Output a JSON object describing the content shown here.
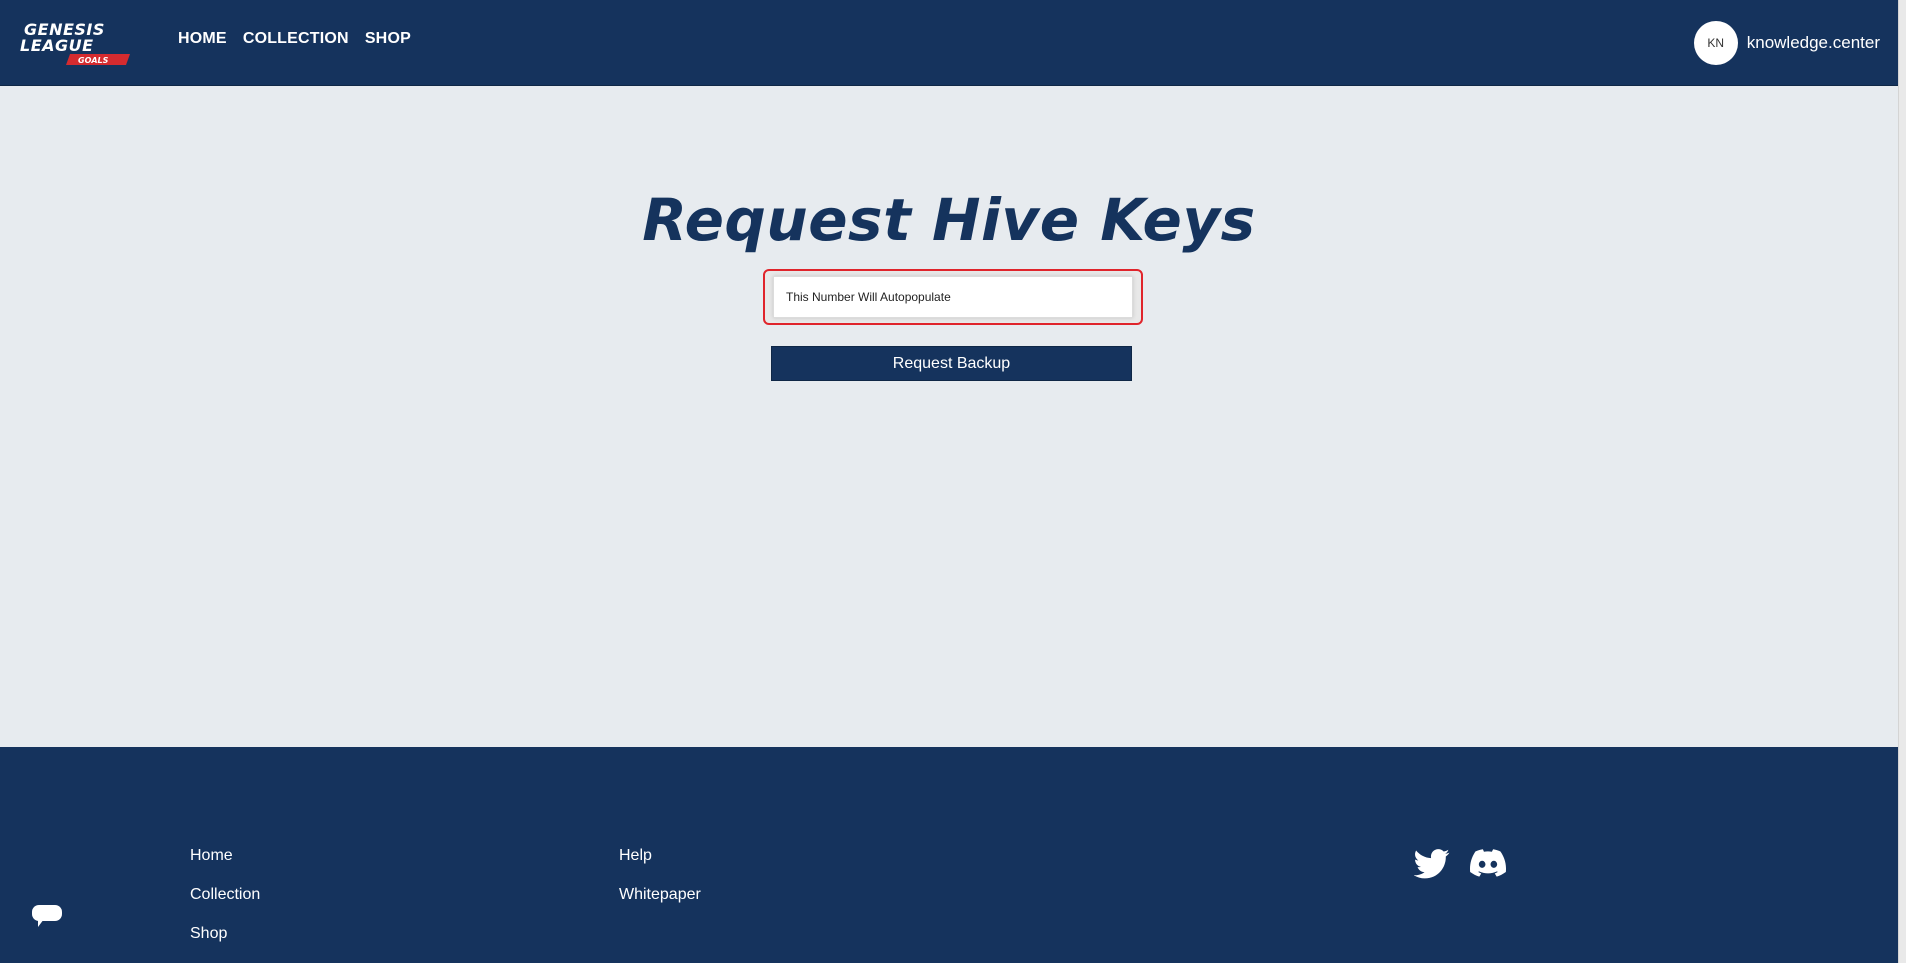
{
  "header": {
    "logo": {
      "line1": "GENESIS",
      "line2": "LEAGUE",
      "line3": "GOALS",
      "accent": "#d52b2f"
    },
    "nav": [
      {
        "label": "HOME"
      },
      {
        "label": "COLLECTION"
      },
      {
        "label": "SHOP"
      }
    ],
    "user": {
      "initials": "KN",
      "name": "knowledge.center"
    }
  },
  "main": {
    "title": "Request Hive Keys",
    "input": {
      "value": "This Number Will Autopopulate",
      "highlight_color": "#e0242b"
    },
    "button_label": "Request Backup"
  },
  "footer": {
    "col1": [
      {
        "label": "Home"
      },
      {
        "label": "Collection"
      },
      {
        "label": "Shop"
      }
    ],
    "col2": [
      {
        "label": "Help"
      },
      {
        "label": "Whitepaper"
      }
    ],
    "social_icons": [
      "twitter-icon",
      "discord-icon"
    ],
    "chat_icon": "chat-bubble-icon"
  },
  "colors": {
    "navy": "#15335d",
    "background": "#e7ebef",
    "white": "#ffffff"
  }
}
